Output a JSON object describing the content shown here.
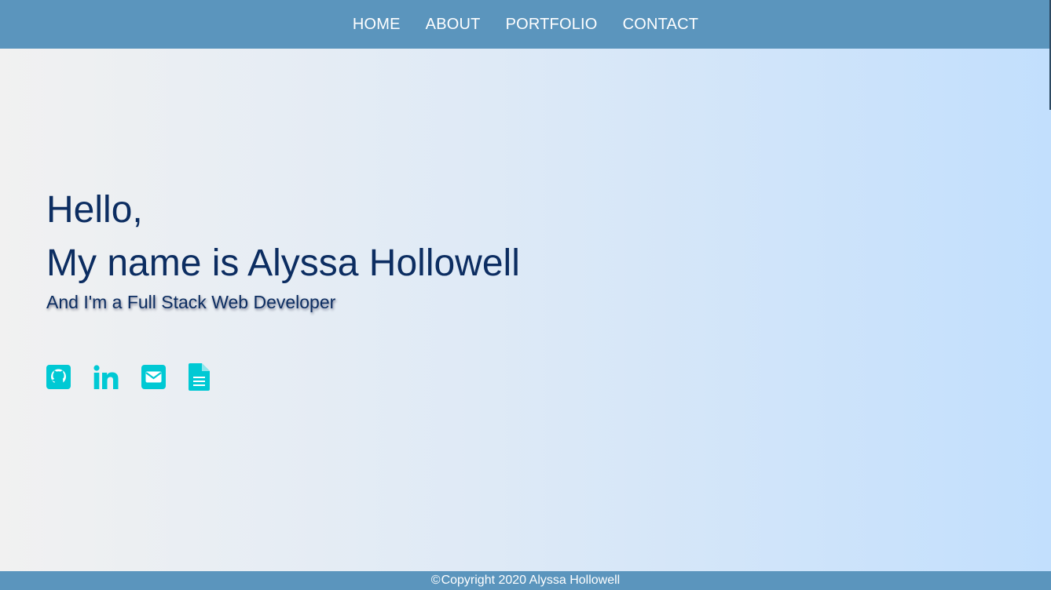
{
  "nav": {
    "links": [
      {
        "label": "HOME"
      },
      {
        "label": "ABOUT"
      },
      {
        "label": "PORTFOLIO"
      },
      {
        "label": "CONTACT"
      }
    ]
  },
  "hero": {
    "greeting": "Hello,",
    "name_line": "My name is Alyssa Hollowell",
    "subtitle": "And I'm a Full Stack Web Developer"
  },
  "social": {
    "icons": [
      "github-icon",
      "linkedin-icon",
      "envelope-icon",
      "file-text-icon"
    ],
    "icon_color": "#00c9d4"
  },
  "footer": {
    "copyright_symbol": "©",
    "text": "Copyright 2020 Alyssa Hollowell"
  },
  "colors": {
    "nav_bg": "#5b95bd",
    "heading": "#0c2d61",
    "gradient_start": "#f1f1f1",
    "gradient_end": "#c2dffd"
  }
}
